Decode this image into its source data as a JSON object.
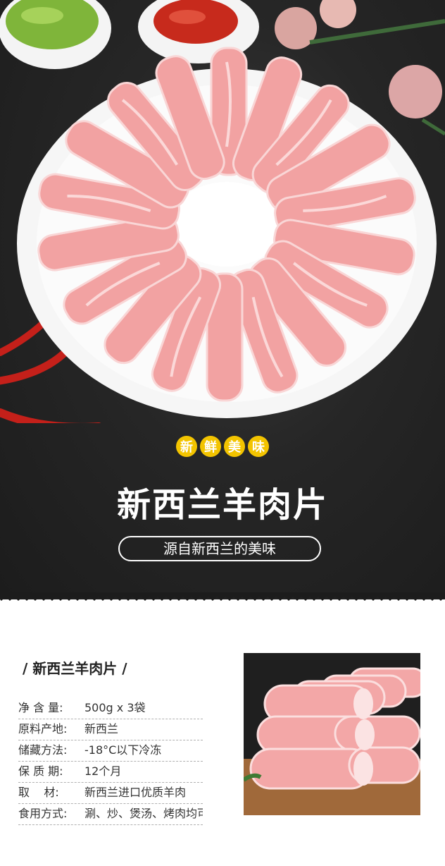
{
  "hero": {
    "badge_chars": [
      "新",
      "鲜",
      "美",
      "味"
    ],
    "title": "新西兰羊肉片",
    "subtitle": "源自新西兰的美味"
  },
  "specs": {
    "title": "/ 新西兰羊肉片 /",
    "rows": [
      {
        "key": "净 含 量:",
        "value": "500g x 3袋"
      },
      {
        "key": "原料产地:",
        "value": "新西兰"
      },
      {
        "key": "储藏方法:",
        "value": "-18°C以下冷冻"
      },
      {
        "key": "保 质 期:",
        "value": "12个月"
      },
      {
        "key": "取    材:",
        "value": "新西兰进口优质羊肉"
      },
      {
        "key": "食用方式:",
        "value": "涮、炒、煲汤、烤肉均可"
      }
    ]
  },
  "colors": {
    "hero_bg": "#262626",
    "badge": "#f3c400",
    "meat": "#f2a2a2",
    "plate": "#f6f6f6"
  }
}
